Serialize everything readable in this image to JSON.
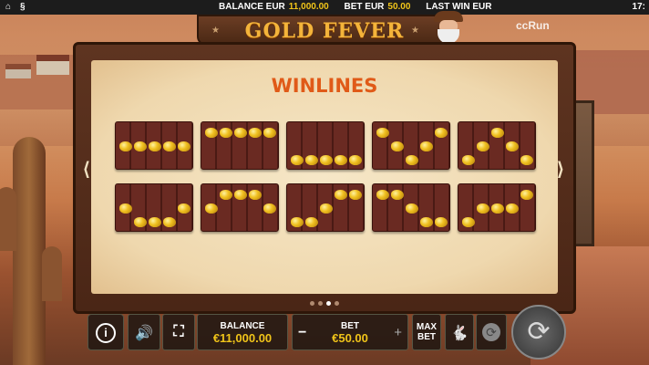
{
  "topbar": {
    "home_icon": "home-icon",
    "settings_icon": "section-icon",
    "balance_label": "BALANCE EUR",
    "balance_value": "11,000.00",
    "bet_label": "BET EUR",
    "bet_value": "50.00",
    "lastwin_label": "LAST WIN EUR",
    "clock": "17:"
  },
  "logo": {
    "title": "GOLD FEVER",
    "brand": "ccRun"
  },
  "paytable": {
    "title": "WINLINES",
    "prev_arrow": "⟨",
    "next_arrow": "⟩",
    "winlines": [
      [
        1,
        1,
        1,
        1,
        1
      ],
      [
        0,
        0,
        0,
        0,
        0
      ],
      [
        2,
        2,
        2,
        2,
        2
      ],
      [
        0,
        1,
        2,
        1,
        0
      ],
      [
        2,
        1,
        0,
        1,
        2
      ],
      [
        1,
        2,
        2,
        2,
        1
      ],
      [
        1,
        0,
        0,
        0,
        1
      ],
      [
        2,
        2,
        1,
        0,
        0
      ],
      [
        0,
        0,
        1,
        2,
        2
      ],
      [
        2,
        1,
        1,
        1,
        0
      ]
    ],
    "pages": 4,
    "active_page": 2
  },
  "controls": {
    "info_icon": "info-icon",
    "sound_icon": "speaker-icon",
    "fullscreen_icon": "fullscreen-icon",
    "balance_label": "BALANCE",
    "balance_value": "€11,000.00",
    "bet_minus": "−",
    "bet_label": "BET",
    "bet_value": "€50.00",
    "bet_plus": "+",
    "maxbet_label_1": "MAX",
    "maxbet_label_2": "BET",
    "turbo_icon": "rabbit-icon",
    "autoplay_icon": "autoplay-icon",
    "spin_icon": "spin-icon"
  },
  "colors": {
    "accent_gold": "#f0c419",
    "title_orange": "#e05a18",
    "frame_brown": "#4a2616"
  }
}
